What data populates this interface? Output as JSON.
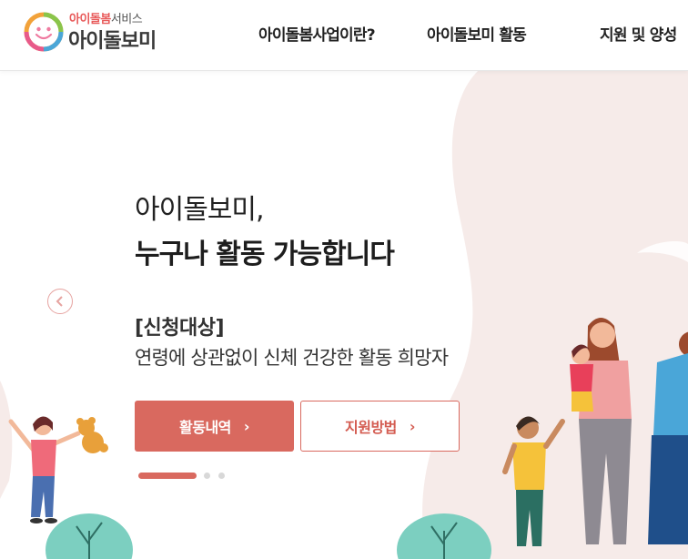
{
  "header": {
    "logo": {
      "subtitle_highlight": "아이돌봄",
      "subtitle_rest": "서비스",
      "title": "아이돌보미"
    },
    "nav": [
      {
        "label": "아이돌봄사업이란?"
      },
      {
        "label": "아이돌보미 활동"
      },
      {
        "label": "지원 및 양성"
      }
    ]
  },
  "hero": {
    "headline_line1": "아이돌보미,",
    "headline_line2": "누구나 활동 가능합니다",
    "target_label": "[신청대상]",
    "target_desc": "연령에 상관없이 신체 건강한 활동 희망자",
    "buttons": {
      "primary_label": "활동내역",
      "secondary_label": "지원방법",
      "arrow": "›"
    },
    "carousel": {
      "slide_count": 3,
      "active_slide": 1
    }
  },
  "colors": {
    "accent": "#d9695f",
    "blob_pink": "#f6ebe9",
    "tree_teal": "#7ccfc0"
  }
}
